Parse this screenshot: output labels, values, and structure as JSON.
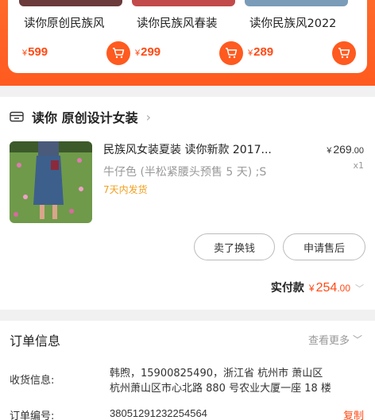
{
  "recommendations": [
    {
      "name": "读你原创民族风",
      "currency": "¥",
      "price": "599"
    },
    {
      "name": "读你民族风春装",
      "currency": "¥",
      "price": "299"
    },
    {
      "name": "读你民族风2022",
      "currency": "¥",
      "price": "289"
    }
  ],
  "order": {
    "shop_name": "读你 原创设计女装",
    "product_title": "民族风女装夏装 读你新款 2017...",
    "price_currency": "¥",
    "price_int": "269",
    "price_dec": ".00",
    "quantity": "x1",
    "spec": "牛仔色 (半松紧腰头预售 5 天) ;S",
    "shipping_note": "7天内发货",
    "sell_button": "卖了换钱",
    "after_sale_button": "申请售后",
    "paid_label": "实付款",
    "paid_currency": "¥",
    "paid_int": "254",
    "paid_dec": ".00"
  },
  "order_info": {
    "title": "订单信息",
    "more": "查看更多",
    "address_label": "收货信息:",
    "address_line1": "韩煦，15900825490，浙江省 杭州市 萧山区",
    "address_line2": "杭州萧山区市心北路 880 号农业大厦一座 18 楼",
    "order_no_label": "订单编号:",
    "order_no": "38051291232254564",
    "copy": "复制"
  },
  "colors": {
    "accent": "#ff5a1f",
    "price": "#ff4a14",
    "shipping": "#f0a020"
  }
}
